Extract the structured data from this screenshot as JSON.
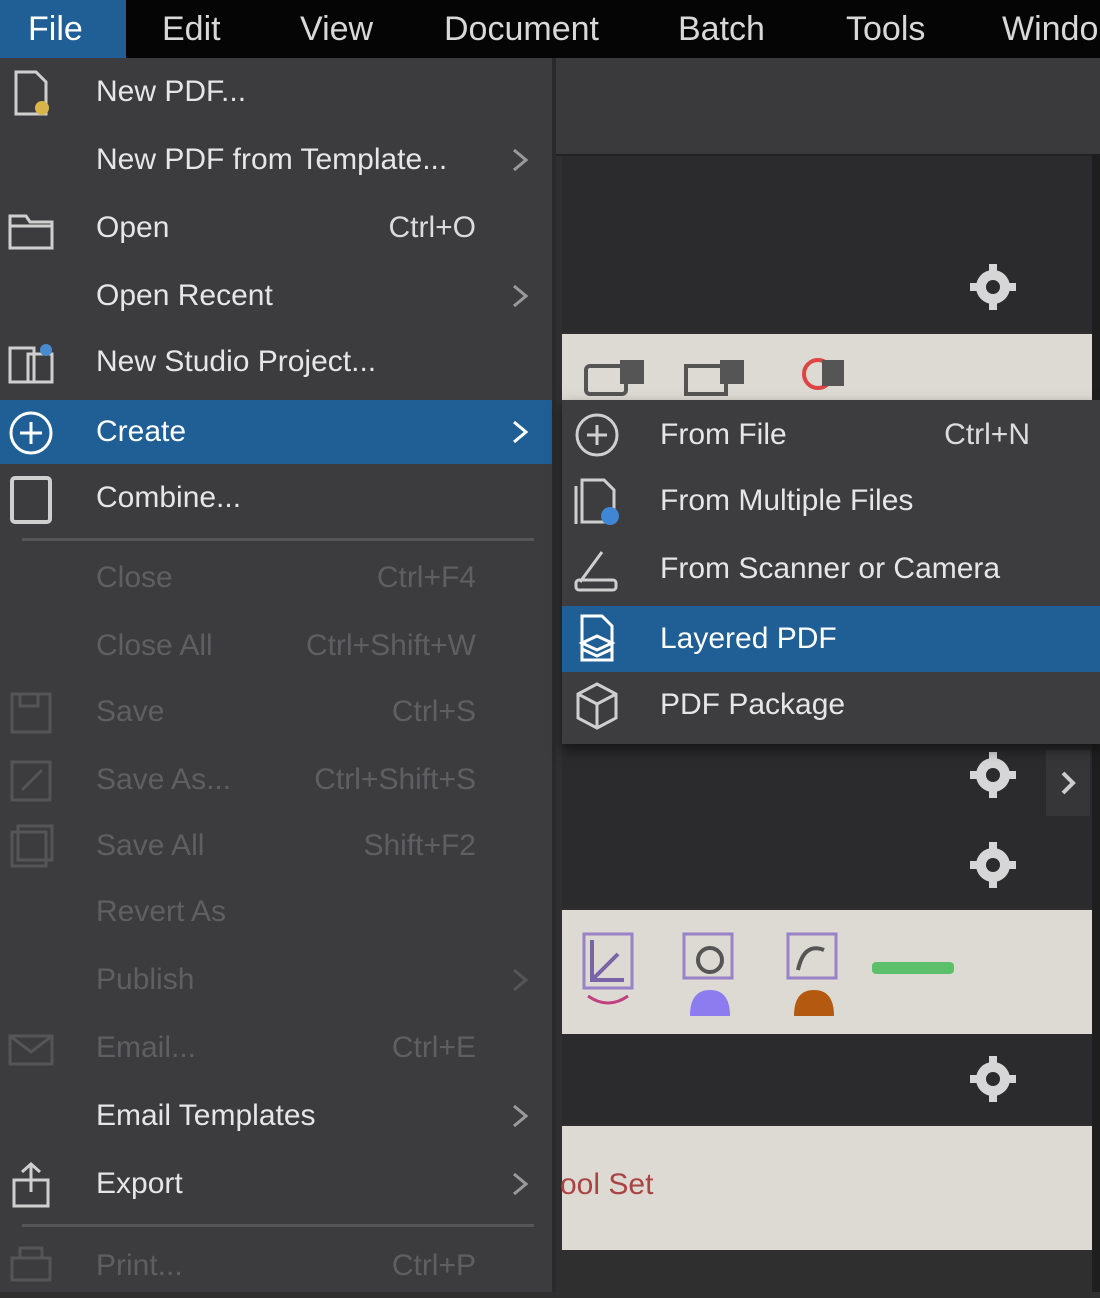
{
  "menubar": {
    "items": [
      "File",
      "Edit",
      "View",
      "Document",
      "Batch",
      "Tools",
      "Windo"
    ]
  },
  "file_menu": {
    "items": [
      {
        "label": "New PDF...",
        "shortcut": "",
        "icon": "new-pdf-icon",
        "state": "enabled"
      },
      {
        "label": "New PDF from Template...",
        "shortcut": "",
        "icon": "",
        "state": "enabled",
        "submenu": true
      },
      {
        "label": "Open",
        "shortcut": "Ctrl+O",
        "icon": "folder-icon",
        "state": "enabled"
      },
      {
        "label": "Open Recent",
        "shortcut": "",
        "icon": "",
        "state": "enabled",
        "submenu": true
      },
      {
        "label": "New Studio Project...",
        "shortcut": "",
        "icon": "studio-project-icon",
        "state": "enabled"
      },
      {
        "label": "Create",
        "shortcut": "",
        "icon": "plus-circle-icon",
        "state": "highlighted",
        "submenu": true
      },
      {
        "label": "Combine...",
        "shortcut": "",
        "icon": "combine-icon",
        "state": "enabled"
      },
      {
        "label": "Close",
        "shortcut": "Ctrl+F4",
        "icon": "",
        "state": "disabled"
      },
      {
        "label": "Close All",
        "shortcut": "Ctrl+Shift+W",
        "icon": "",
        "state": "disabled"
      },
      {
        "label": "Save",
        "shortcut": "Ctrl+S",
        "icon": "save-icon",
        "state": "disabled"
      },
      {
        "label": "Save As...",
        "shortcut": "Ctrl+Shift+S",
        "icon": "save-as-icon",
        "state": "disabled"
      },
      {
        "label": "Save All",
        "shortcut": "Shift+F2",
        "icon": "save-all-icon",
        "state": "disabled"
      },
      {
        "label": "Revert As",
        "shortcut": "",
        "icon": "",
        "state": "disabled"
      },
      {
        "label": "Publish",
        "shortcut": "",
        "icon": "",
        "state": "disabled",
        "submenu": true
      },
      {
        "label": "Email...",
        "shortcut": "Ctrl+E",
        "icon": "email-icon",
        "state": "disabled"
      },
      {
        "label": "Email Templates",
        "shortcut": "",
        "icon": "",
        "state": "enabled",
        "submenu": true
      },
      {
        "label": "Export",
        "shortcut": "",
        "icon": "export-icon",
        "state": "enabled",
        "submenu": true
      },
      {
        "label": "Print...",
        "shortcut": "Ctrl+P",
        "icon": "print-icon",
        "state": "disabled"
      }
    ]
  },
  "create_submenu": {
    "items": [
      {
        "label": "From File",
        "shortcut": "Ctrl+N",
        "icon": "from-file-icon",
        "state": "enabled"
      },
      {
        "label": "From Multiple Files",
        "shortcut": "",
        "icon": "multiple-files-icon",
        "state": "enabled"
      },
      {
        "label": "From Scanner or Camera",
        "shortcut": "",
        "icon": "scanner-icon",
        "state": "enabled"
      },
      {
        "label": "Layered PDF",
        "shortcut": "",
        "icon": "layered-pdf-icon",
        "state": "highlighted"
      },
      {
        "label": "PDF Package",
        "shortcut": "",
        "icon": "pdf-package-icon",
        "state": "enabled"
      }
    ]
  },
  "background": {
    "tool_set_label": "ool Set"
  },
  "colors": {
    "menubar_bg": "#050505",
    "menu_bg": "#3c3c3e",
    "highlight": "#1f5f95",
    "disabled_text": "#5f5f62",
    "panel_light": "#dcdad2"
  }
}
